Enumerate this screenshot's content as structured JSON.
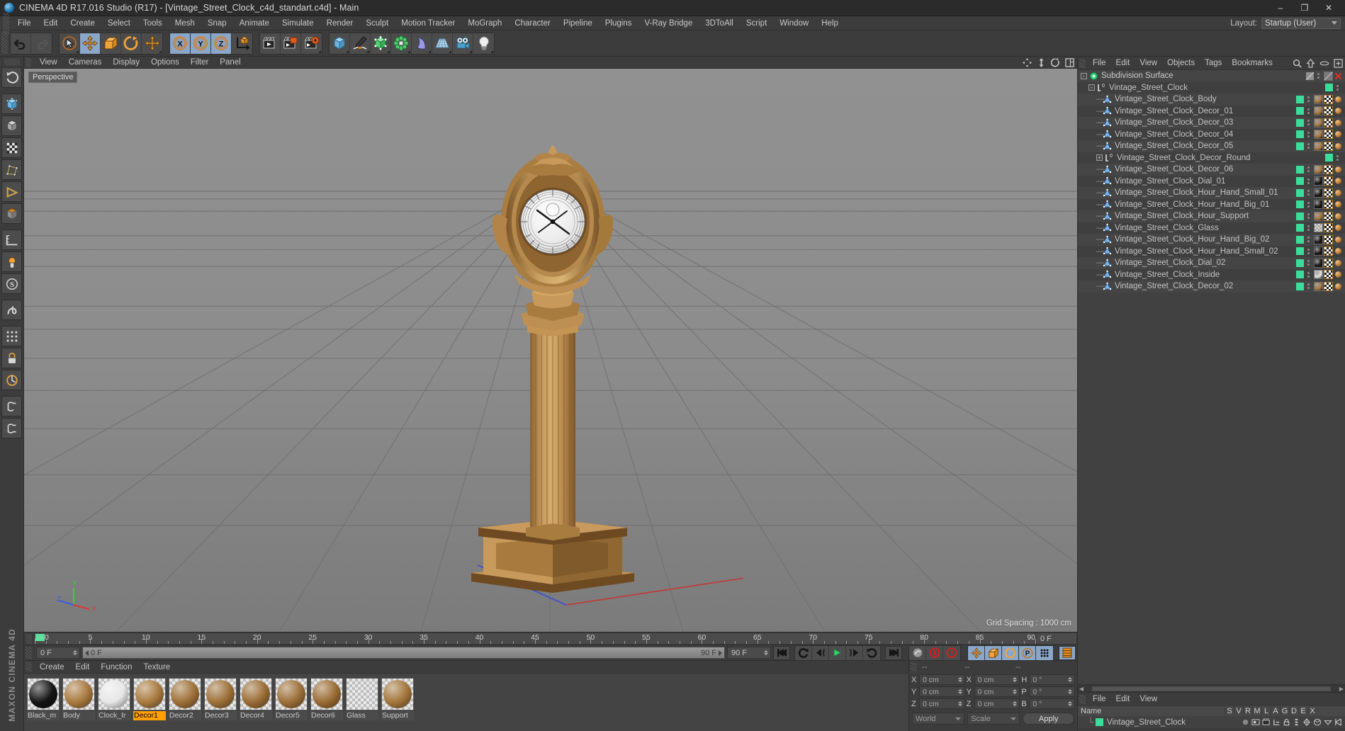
{
  "app": {
    "title": "CINEMA 4D R17.016 Studio (R17) - [Vintage_Street_Clock_c4d_standart.c4d] - Main",
    "logo_name": "cinema4d-logo",
    "brand": "MAXON CINEMA 4D"
  },
  "window_controls": {
    "minimize": "–",
    "maximize": "❐",
    "close": "✕"
  },
  "menubar": {
    "items": [
      "File",
      "Edit",
      "Create",
      "Select",
      "Tools",
      "Mesh",
      "Snap",
      "Animate",
      "Simulate",
      "Render",
      "Sculpt",
      "Motion Tracker",
      "MoGraph",
      "Character",
      "Pipeline",
      "Plugins",
      "V-Ray Bridge",
      "3DToAll",
      "Script",
      "Window",
      "Help"
    ],
    "layout_label": "Layout:",
    "layout_value": "Startup (User)"
  },
  "toolbar": {
    "groups": [
      {
        "name": "undo-redo",
        "buttons": [
          {
            "name": "undo-button",
            "icon": "undo-icon"
          },
          {
            "name": "redo-button",
            "icon": "redo-icon"
          }
        ]
      },
      {
        "name": "transform-tools",
        "buttons": [
          {
            "name": "live-selection-button",
            "icon": "cursor-select-icon"
          },
          {
            "name": "move-tool-button",
            "icon": "move-icon",
            "active": true
          },
          {
            "name": "scale-tool-button",
            "icon": "scale-icon"
          },
          {
            "name": "rotate-tool-button",
            "icon": "rotate-icon"
          },
          {
            "name": "dynamic-place-button",
            "icon": "move-icon"
          }
        ]
      },
      {
        "name": "axis-locks",
        "buttons": [
          {
            "name": "lock-x-button",
            "icon": "axis-x-icon",
            "active": true
          },
          {
            "name": "lock-y-button",
            "icon": "axis-y-icon",
            "active": true
          },
          {
            "name": "lock-z-button",
            "icon": "axis-z-icon",
            "active": true
          },
          {
            "name": "world-object-coordinates-button",
            "icon": "world-axis-icon"
          }
        ]
      },
      {
        "name": "render-tools",
        "buttons": [
          {
            "name": "render-view-button",
            "icon": "render-view-icon"
          },
          {
            "name": "render-region-button",
            "icon": "render-region-icon"
          },
          {
            "name": "render-settings-button",
            "icon": "render-settings-icon"
          }
        ]
      },
      {
        "name": "create-objects",
        "buttons": [
          {
            "name": "add-cube-button",
            "icon": "cube-icon"
          },
          {
            "name": "add-spline-button",
            "icon": "pen-spline-icon"
          },
          {
            "name": "add-generator-button",
            "icon": "generator-icon"
          },
          {
            "name": "add-array-button",
            "icon": "array-icon"
          },
          {
            "name": "add-deformer-button",
            "icon": "bend-deformer-icon"
          },
          {
            "name": "add-scene-button",
            "icon": "floor-grid-icon"
          },
          {
            "name": "add-camera-button",
            "icon": "camera-icon"
          },
          {
            "name": "add-light-button",
            "icon": "light-bulb-icon"
          }
        ]
      }
    ]
  },
  "left_toolbar": {
    "buttons": [
      {
        "name": "undo-view-button",
        "icon": "undo-view-icon"
      },
      {
        "name": "make-editable-button",
        "icon": "make-editable-icon"
      },
      {
        "name": "model-mode-button",
        "icon": "model-mode-icon"
      },
      {
        "name": "texture-mode-button",
        "icon": "texture-mode-icon"
      },
      {
        "name": "points-mode-button",
        "icon": "points-mode-icon"
      },
      {
        "name": "edges-mode-button",
        "icon": "edges-mode-icon"
      },
      {
        "name": "polygons-mode-button",
        "icon": "polygons-mode-icon"
      },
      {
        "name": "workplane-button",
        "icon": "workplane-icon"
      },
      {
        "name": "enable-axis-button",
        "icon": "axis-modify-icon"
      },
      {
        "name": "snap-settings-button",
        "icon": "snap-icon"
      },
      {
        "name": "viewport-solo-button",
        "icon": "solo-icon"
      },
      {
        "name": "lock-axis-button",
        "icon": "lock-axis-icon"
      },
      {
        "name": "quantize-button",
        "icon": "quantize-icon"
      },
      {
        "name": "deformer-off-button",
        "icon": "deform-off-icon"
      },
      {
        "name": "anim-layers-button",
        "icon": "anim-layers-icon"
      }
    ]
  },
  "viewport": {
    "menu": [
      "View",
      "Cameras",
      "Display",
      "Options",
      "Filter",
      "Panel"
    ],
    "label": "Perspective",
    "grid_spacing": "Grid Spacing : 1000 cm",
    "axis_labels": {
      "x": "X",
      "y": "Y",
      "z": "Z"
    },
    "icons": [
      "pan-view-icon",
      "zoom-view-icon",
      "rotate-view-icon",
      "layout-view-icon"
    ],
    "model_name": "vintage-street-clock"
  },
  "timeline": {
    "ticks": [
      0,
      5,
      10,
      15,
      20,
      25,
      30,
      35,
      40,
      45,
      50,
      55,
      60,
      65,
      70,
      75,
      80,
      85,
      90
    ],
    "start_frame": "0 F",
    "current_frame": "0 F",
    "end_frame_field": "90 F",
    "end_frame_right": "90 F",
    "right_field": "0 F",
    "transport": [
      {
        "name": "go-to-start-button",
        "icon": "skip-start-icon"
      },
      {
        "name": "previous-key-button",
        "icon": "prev-key-icon"
      },
      {
        "name": "step-back-button",
        "icon": "step-back-icon"
      },
      {
        "name": "play-button",
        "icon": "play-icon"
      },
      {
        "name": "step-forward-button",
        "icon": "step-forward-icon"
      },
      {
        "name": "next-key-button",
        "icon": "next-key-icon"
      },
      {
        "name": "go-to-end-button",
        "icon": "skip-end-icon"
      }
    ],
    "record_tools": [
      {
        "name": "autokeying-button",
        "icon": "autokey-icon"
      },
      {
        "name": "record-active-objects-button",
        "icon": "record-icon"
      },
      {
        "name": "keyframe-selection-button",
        "icon": "keyframe-help-icon"
      }
    ],
    "key_toggles": [
      {
        "name": "position-key-button",
        "icon": "position-key-icon",
        "active": true
      },
      {
        "name": "scale-key-button",
        "icon": "scale-key-icon",
        "active": true
      },
      {
        "name": "rotation-key-button",
        "icon": "rotation-key-icon",
        "active": true
      },
      {
        "name": "parameter-key-button",
        "icon": "param-key-icon",
        "active": true
      },
      {
        "name": "point-level-anim-button",
        "icon": "pla-icon",
        "active": true
      }
    ],
    "extra_button": {
      "name": "timeline-settings-button",
      "icon": "timeline-settings-icon"
    }
  },
  "materials": {
    "menu": [
      "Create",
      "Edit",
      "Function",
      "Texture"
    ],
    "items": [
      {
        "name": "Black_m",
        "color": "#141414",
        "selected": false
      },
      {
        "name": "Body",
        "color": "#a8793f",
        "selected": false
      },
      {
        "name": "Clock_Ir",
        "color": "#e7e7e7",
        "selected": false
      },
      {
        "name": "Decor1",
        "color": "#a87a40",
        "selected": true
      },
      {
        "name": "Decor2",
        "color": "#9d6f37",
        "selected": false
      },
      {
        "name": "Decor3",
        "color": "#9d7038",
        "selected": false
      },
      {
        "name": "Decor4",
        "color": "#9a6c35",
        "selected": false
      },
      {
        "name": "Decor5",
        "color": "#9c6f38",
        "selected": false
      },
      {
        "name": "Decor6",
        "color": "#996b33",
        "selected": false
      },
      {
        "name": "Glass",
        "color": "transparent",
        "selected": false
      },
      {
        "name": "Support",
        "color": "#a3763c",
        "selected": false
      }
    ]
  },
  "coordinates": {
    "header": [
      "--",
      "--",
      "--"
    ],
    "rows": [
      {
        "label1": "X",
        "value1": "0 cm",
        "label2": "X",
        "value2": "0 cm",
        "label3": "H",
        "value3": "0 °"
      },
      {
        "label1": "Y",
        "value1": "0 cm",
        "label2": "Y",
        "value2": "0 cm",
        "label3": "P",
        "value3": "0 °"
      },
      {
        "label1": "Z",
        "value1": "0 cm",
        "label2": "Z",
        "value2": "0 cm",
        "label3": "B",
        "value3": "0 °"
      }
    ],
    "system": "World",
    "mode": "Scale",
    "apply": "Apply"
  },
  "object_manager": {
    "menu": [
      "File",
      "Edit",
      "View",
      "Objects",
      "Tags",
      "Bookmarks"
    ],
    "icons": [
      "search-icon",
      "up-level-icon",
      "ellipse-icon",
      "new-layer-icon"
    ],
    "items": [
      {
        "label": "Subdivision Surface",
        "depth": 0,
        "icon": "subdivision-icon",
        "expander": "-",
        "enabled": false,
        "tags": [
          "disabled-tag",
          "delete-x-tag"
        ]
      },
      {
        "label": "Vintage_Street_Clock",
        "depth": 1,
        "icon": "null-object-icon",
        "expander": "-",
        "enabled": true,
        "tags": []
      },
      {
        "label": "Vintage_Street_Clock_Body",
        "depth": 2,
        "icon": "polygon-object-icon",
        "enabled": true,
        "tags": [
          "material-brown",
          "checker",
          "dot-orange"
        ]
      },
      {
        "label": "Vintage_Street_Clock_Decor_01",
        "depth": 2,
        "icon": "polygon-object-icon",
        "enabled": true,
        "tags": [
          "material-brown",
          "checker",
          "dot-orange"
        ]
      },
      {
        "label": "Vintage_Street_Clock_Decor_03",
        "depth": 2,
        "icon": "polygon-object-icon",
        "enabled": true,
        "tags": [
          "material-brown",
          "checker",
          "dot-orange"
        ]
      },
      {
        "label": "Vintage_Street_Clock_Decor_04",
        "depth": 2,
        "icon": "polygon-object-icon",
        "enabled": true,
        "tags": [
          "material-brown",
          "checker",
          "dot-orange"
        ]
      },
      {
        "label": "Vintage_Street_Clock_Decor_05",
        "depth": 2,
        "icon": "polygon-object-icon",
        "enabled": true,
        "tags": [
          "material-brown",
          "checker",
          "dot-orange"
        ]
      },
      {
        "label": "Vintage_Street_Clock_Decor_Round",
        "depth": 2,
        "icon": "null-object-icon",
        "expander": "+",
        "enabled": true,
        "tags": []
      },
      {
        "label": "Vintage_Street_Clock_Decor_06",
        "depth": 2,
        "icon": "polygon-object-icon",
        "enabled": true,
        "tags": [
          "material-brown",
          "checker",
          "dot-orange"
        ]
      },
      {
        "label": "Vintage_Street_Clock_Dial_01",
        "depth": 2,
        "icon": "polygon-object-icon",
        "enabled": true,
        "tags": [
          "material-black",
          "checker",
          "dot-orange"
        ]
      },
      {
        "label": "Vintage_Street_Clock_Hour_Hand_Small_01",
        "depth": 2,
        "icon": "polygon-object-icon",
        "enabled": true,
        "tags": [
          "material-black",
          "checker",
          "dot-orange"
        ]
      },
      {
        "label": "Vintage_Street_Clock_Hour_Hand_Big_01",
        "depth": 2,
        "icon": "polygon-object-icon",
        "enabled": true,
        "tags": [
          "material-black",
          "checker",
          "dot-orange"
        ]
      },
      {
        "label": "Vintage_Street_Clock_Hour_Support",
        "depth": 2,
        "icon": "polygon-object-icon",
        "enabled": true,
        "tags": [
          "material-brown",
          "checker",
          "dot-orange"
        ]
      },
      {
        "label": "Vintage_Street_Clock_Glass",
        "depth": 2,
        "icon": "polygon-object-icon",
        "enabled": true,
        "tags": [
          "material-glass",
          "checker",
          "dot-orange"
        ]
      },
      {
        "label": "Vintage_Street_Clock_Hour_Hand_Big_02",
        "depth": 2,
        "icon": "polygon-object-icon",
        "enabled": true,
        "tags": [
          "material-black",
          "checker",
          "dot-orange"
        ]
      },
      {
        "label": "Vintage_Street_Clock_Hour_Hand_Small_02",
        "depth": 2,
        "icon": "polygon-object-icon",
        "enabled": true,
        "tags": [
          "material-black",
          "checker",
          "dot-orange"
        ]
      },
      {
        "label": "Vintage_Street_Clock_Dial_02",
        "depth": 2,
        "icon": "polygon-object-icon",
        "enabled": true,
        "tags": [
          "material-black",
          "checker",
          "dot-orange"
        ]
      },
      {
        "label": "Vintage_Street_Clock_Inside",
        "depth": 2,
        "icon": "polygon-object-icon",
        "enabled": true,
        "tags": [
          "material-white",
          "checker",
          "dot-orange"
        ]
      },
      {
        "label": "Vintage_Street_Clock_Decor_02",
        "depth": 2,
        "icon": "polygon-object-icon",
        "enabled": true,
        "tags": [
          "material-brown",
          "checker",
          "dot-orange"
        ]
      }
    ]
  },
  "layer_manager": {
    "menu": [
      "File",
      "Edit",
      "View"
    ],
    "columns": [
      "Name",
      "S",
      "V",
      "R",
      "M",
      "L",
      "A",
      "G",
      "D",
      "E",
      "X"
    ],
    "rows": [
      {
        "name": "Vintage_Street_Clock",
        "color": "#3bdd9a"
      }
    ]
  }
}
